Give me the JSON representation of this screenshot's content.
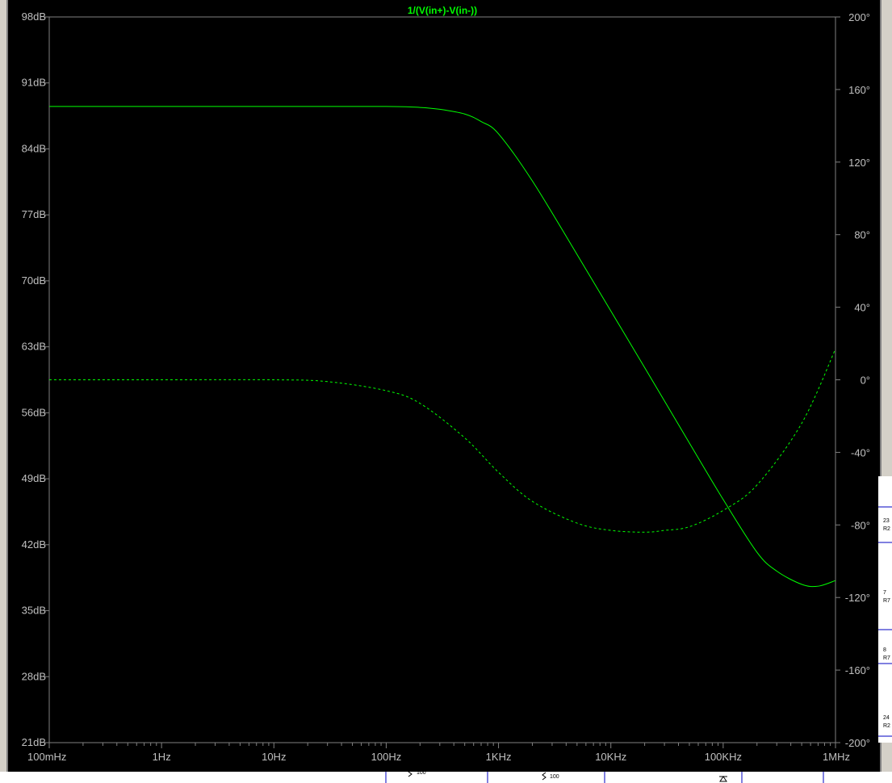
{
  "chart_data": {
    "type": "line",
    "title": "1/(V(in+)-V(in-))",
    "x_scale": "log",
    "xlim": [
      0.1,
      1000000
    ],
    "x_tick_labels": [
      "100mHz",
      "1Hz",
      "10Hz",
      "100Hz",
      "1KHz",
      "10KHz",
      "100KHz",
      "1MHz"
    ],
    "x_tick_values": [
      0.1,
      1,
      10,
      100,
      1000,
      10000,
      100000,
      1000000
    ],
    "ylim": [
      21,
      98
    ],
    "y_tick_labels": [
      "98dB",
      "91dB",
      "84dB",
      "77dB",
      "70dB",
      "63dB",
      "56dB",
      "49dB",
      "42dB",
      "35dB",
      "28dB",
      "21dB"
    ],
    "y_tick_values": [
      98,
      91,
      84,
      77,
      70,
      63,
      56,
      49,
      42,
      35,
      28,
      21
    ],
    "y2lim": [
      -200,
      200
    ],
    "y2_tick_labels": [
      "200°",
      "160°",
      "120°",
      "80°",
      "40°",
      "0°",
      "-40°",
      "-80°",
      "-120°",
      "-160°",
      "-200°"
    ],
    "y2_tick_values": [
      200,
      160,
      120,
      80,
      40,
      0,
      -40,
      -80,
      -120,
      -160,
      -200
    ],
    "grid": false,
    "series": [
      {
        "style": "solid",
        "axis": "left",
        "unit": "dB",
        "x": [
          0.1,
          1,
          10,
          100,
          200,
          300,
          500,
          700,
          1000,
          2000,
          5000,
          10000,
          20000,
          50000,
          100000,
          200000,
          300000,
          500000,
          700000,
          1000000
        ],
        "y": [
          88.5,
          88.5,
          88.5,
          88.5,
          88.4,
          88.2,
          87.7,
          86.9,
          85.6,
          80.6,
          72.8,
          66.8,
          60.8,
          52.8,
          46.8,
          41.2,
          39.2,
          37.8,
          37.6,
          38.2
        ]
      },
      {
        "style": "dashed",
        "axis": "right",
        "unit": "°",
        "x": [
          0.1,
          1,
          10,
          30,
          100,
          200,
          500,
          1000,
          2000,
          5000,
          10000,
          20000,
          30000,
          50000,
          100000,
          200000,
          500000,
          1000000
        ],
        "y": [
          0,
          0,
          0,
          -1,
          -6,
          -13,
          -32,
          -51,
          -67,
          -79,
          -83,
          -84,
          -83,
          -81,
          -72,
          -58,
          -24,
          17
        ]
      }
    ]
  },
  "colors": {
    "trace": "#00ff00",
    "background": "#000000",
    "axis": "#808080",
    "labels": "#c0c0c0",
    "title": "#00ff00"
  },
  "schematic": {
    "labels": [
      "23",
      "R2",
      "7",
      "R7",
      "8",
      "R7",
      "24",
      "R2",
      "100",
      "100"
    ]
  }
}
